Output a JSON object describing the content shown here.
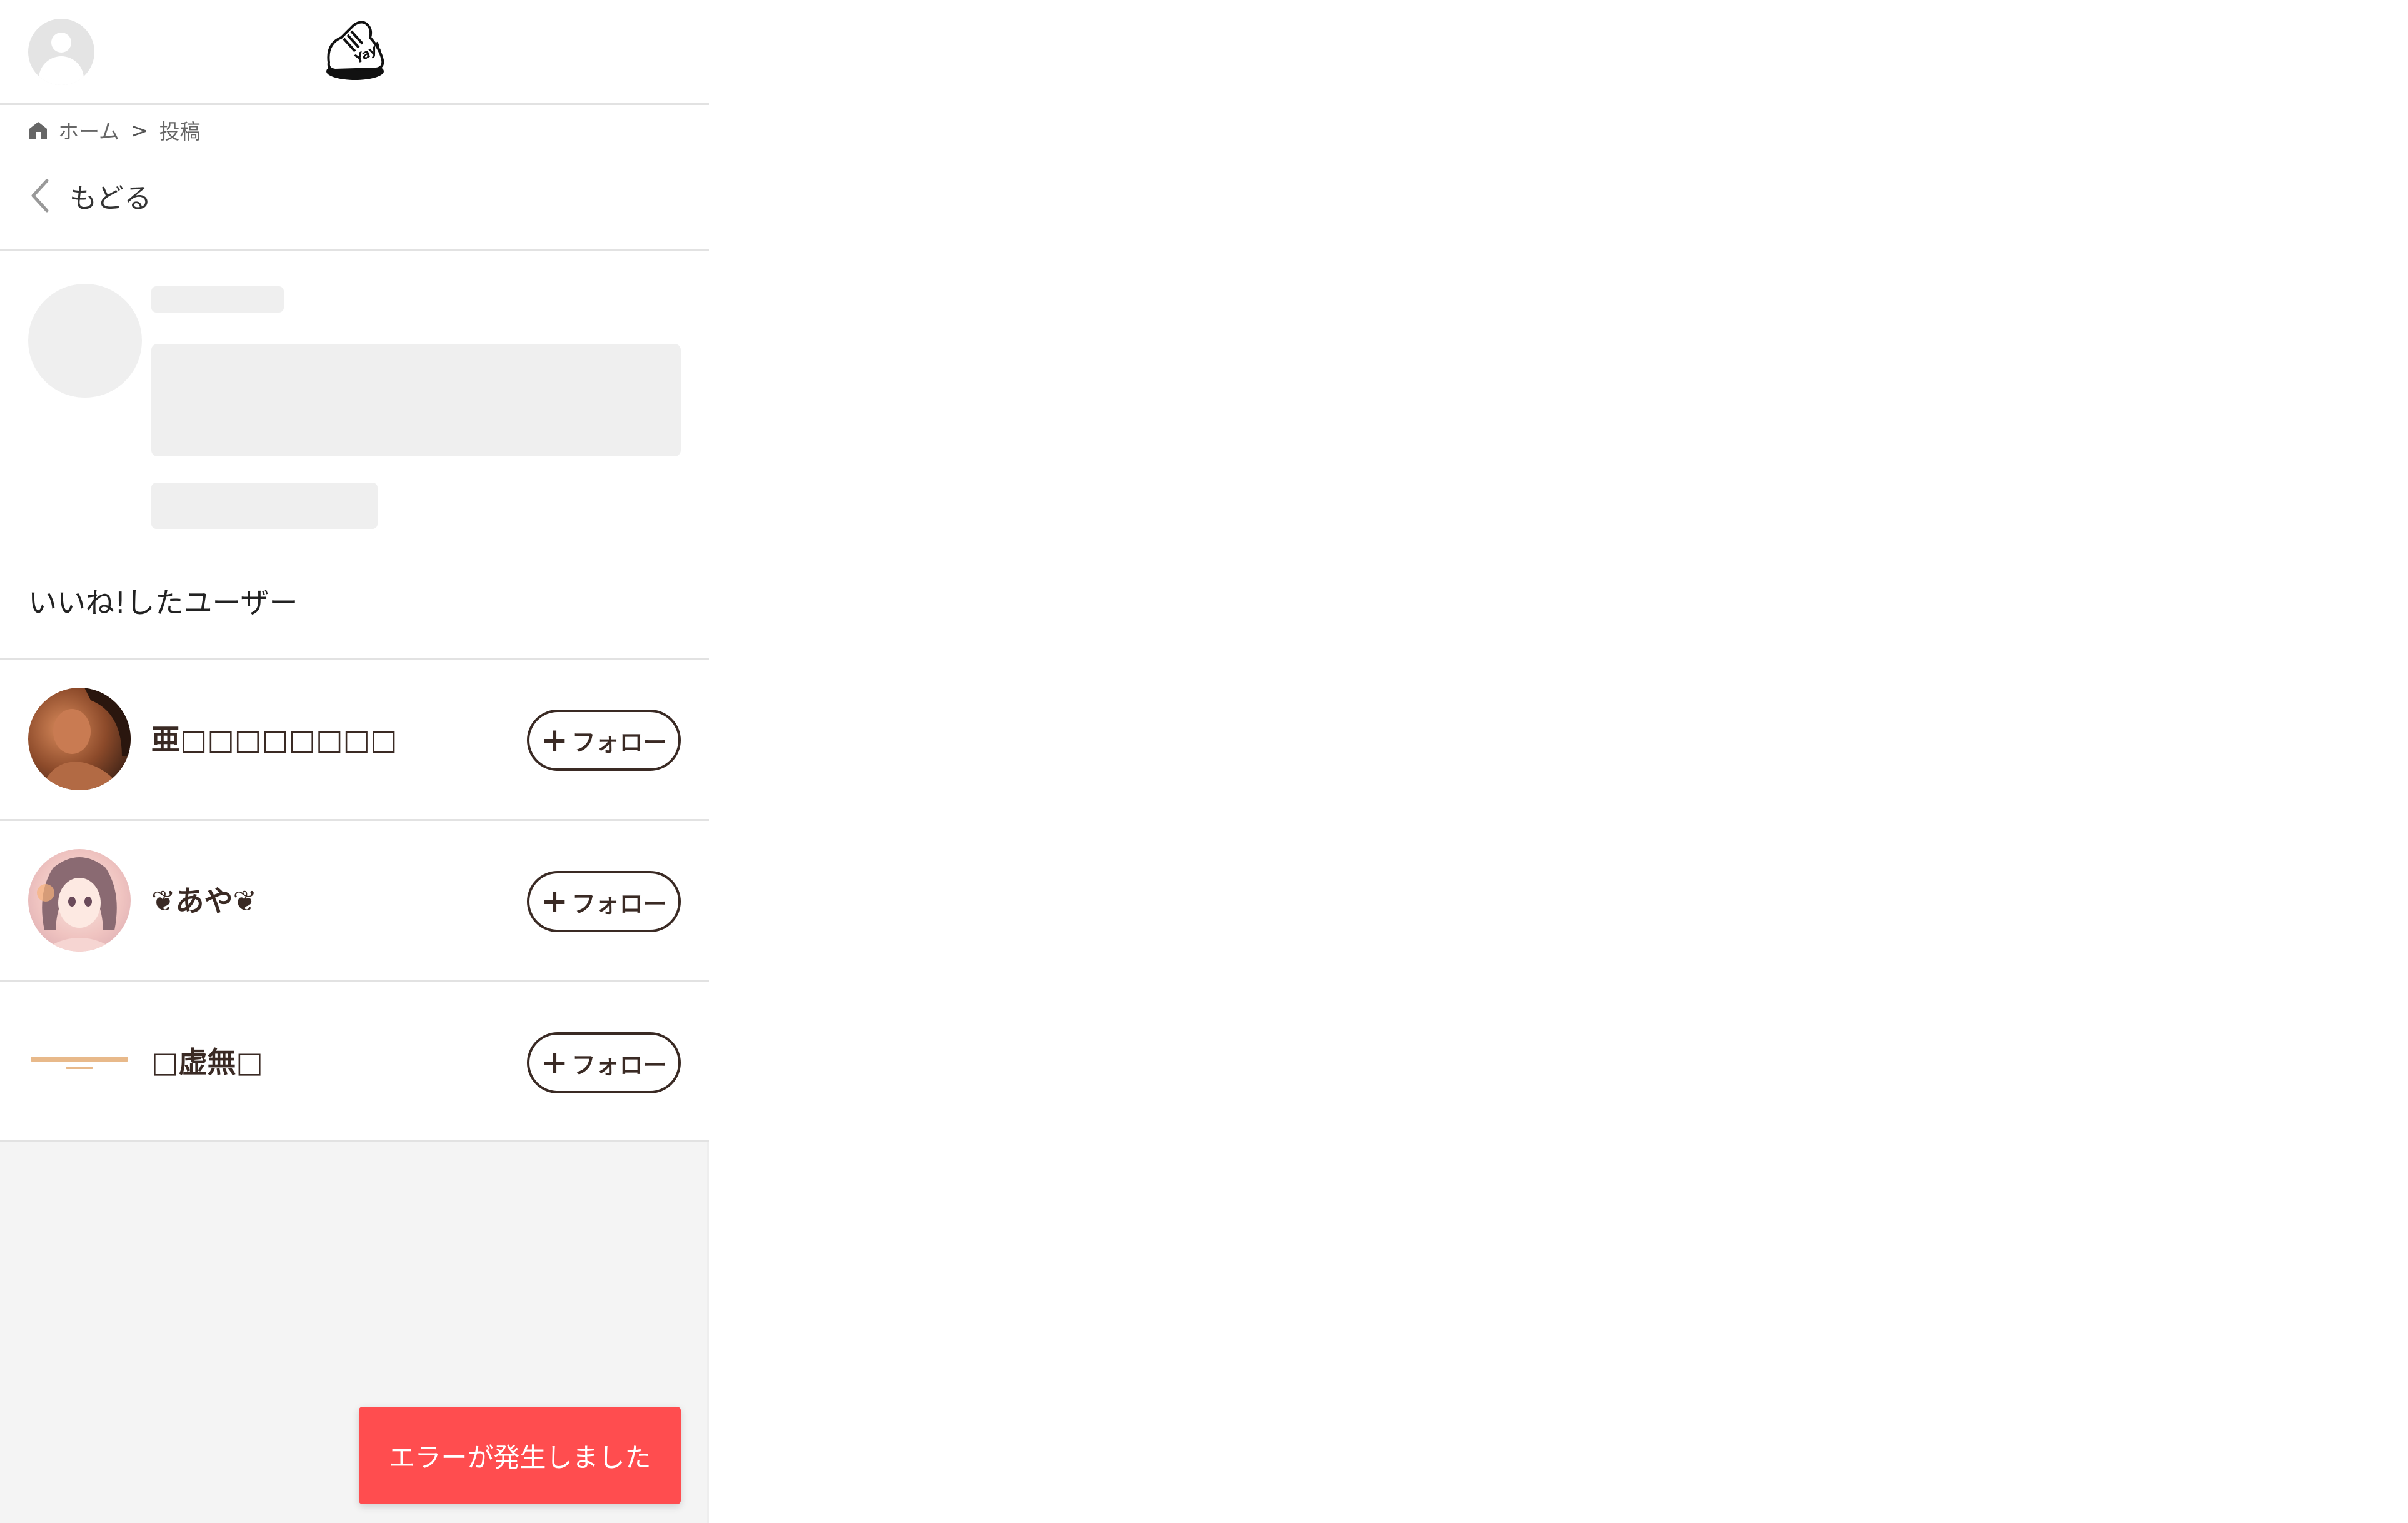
{
  "header": {
    "avatar_icon": "default-user-avatar-icon",
    "logo_icon": "yay-sneaker-logo",
    "logo_text": "Yay!"
  },
  "breadcrumb": {
    "home": "ホーム",
    "separator": ">",
    "current": "投稿"
  },
  "back": {
    "label": "もどる"
  },
  "likes_section": {
    "title": "いいね!したユーザー",
    "users": [
      {
        "name": "亜□□□□□□□□",
        "follow_label": "フォロー",
        "avatar": "photo-avatar-brown"
      },
      {
        "name": "❦あや❦",
        "follow_label": "フォロー",
        "avatar": "anime-girl-avatar"
      },
      {
        "name": "□虚無□",
        "follow_label": "フォロー",
        "avatar": "text-banner-avatar"
      }
    ]
  },
  "toast": {
    "message": "エラーが発生しました",
    "color": "#ff4d4f"
  },
  "colors": {
    "accent": "#3a2a24",
    "skeleton": "#efefef",
    "background": "#f4f4f4"
  }
}
